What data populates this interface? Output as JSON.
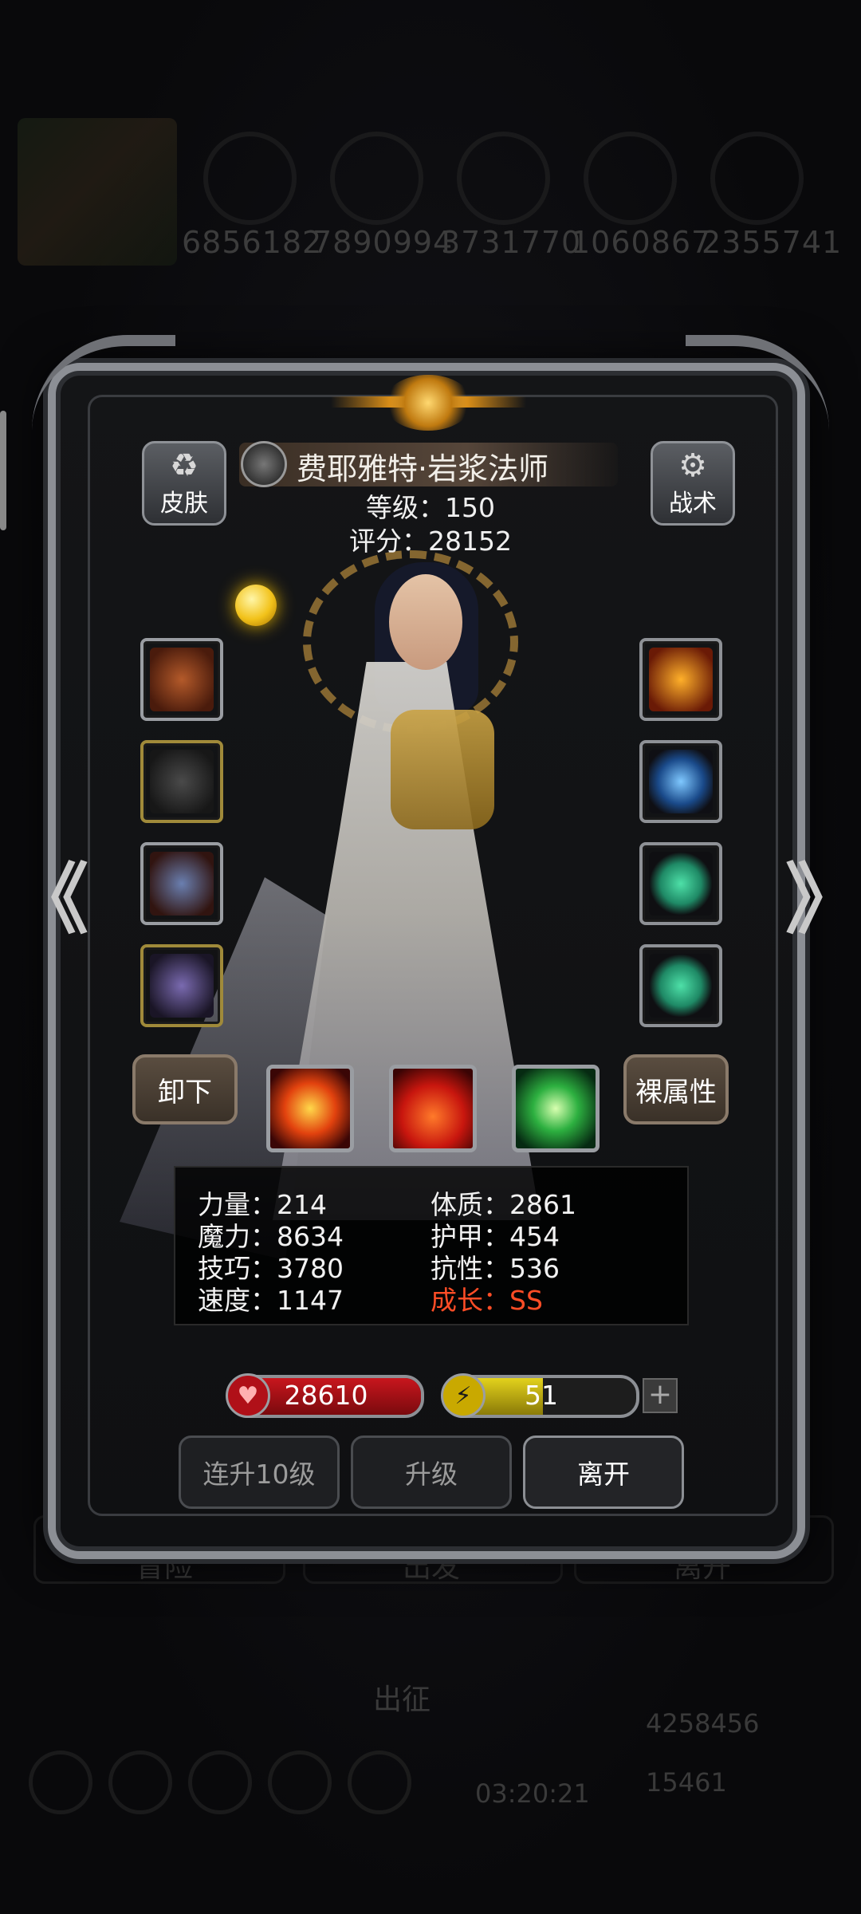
{
  "background": {
    "resources": [
      "6856182",
      "7890994",
      "3731770",
      "1060867",
      "2355741"
    ],
    "bottom_tabs": [
      "冒险",
      "出发",
      "离开"
    ],
    "march_label": "出征",
    "timer": "03:20:21",
    "gold": "4258456",
    "gems": "15461"
  },
  "hero": {
    "name": "费耶雅特·岩浆法师",
    "level": "等级：150",
    "score": "评分：28152"
  },
  "buttons": {
    "skin": "皮肤",
    "tactics": "战术",
    "unequip": "卸下",
    "base_attributes": "裸属性",
    "level_up_10": "连升10级",
    "level_up": "升级",
    "leave": "离开"
  },
  "nav": {
    "prev": "《",
    "next": "》"
  },
  "stats": {
    "strength": "力量：214",
    "magic": "魔力：8634",
    "skill": "技巧：3780",
    "speed": "速度：1147",
    "constitution": "体质：2861",
    "armor": "护甲：454",
    "resistance": "抗性：536",
    "growth": "成长：SS"
  },
  "bars": {
    "hp": "28610",
    "hp_fill": 1.0,
    "energy": "51",
    "energy_fill": 0.51
  },
  "colors": {
    "hp": "#c8161d",
    "energy": "#e3d21c",
    "growth": "#ff4d26"
  }
}
